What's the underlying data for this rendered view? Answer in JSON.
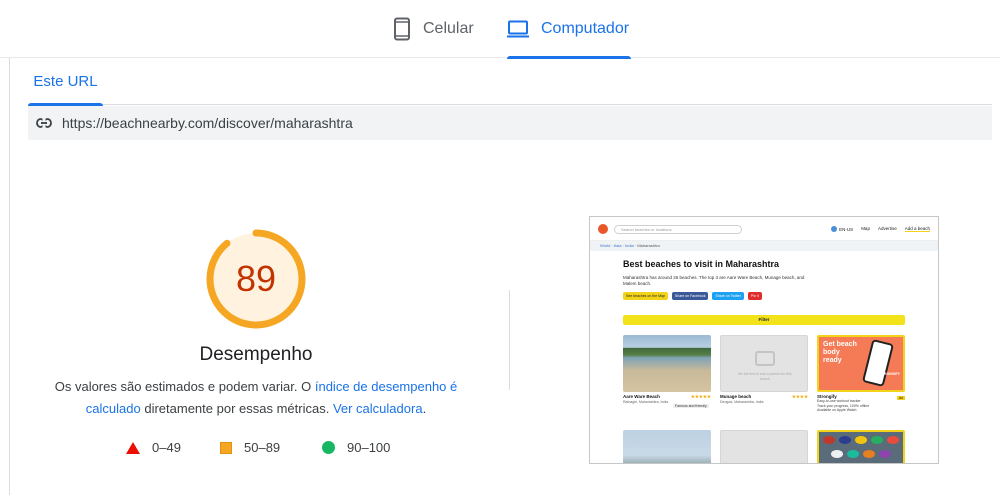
{
  "device_tabs": [
    {
      "label": "Celular",
      "icon": "phone-icon",
      "selected": false
    },
    {
      "label": "Computador",
      "icon": "laptop-icon",
      "selected": true
    }
  ],
  "url_tab": {
    "label": "Este URL"
  },
  "url_bar": {
    "url": "https://beachnearby.com/discover/maharashtra",
    "icon": "link-icon"
  },
  "performance": {
    "score": "89",
    "score_fraction": 0.89,
    "title": "Desempenho",
    "desc_part1": "Os valores são estimados e podem variar. O ",
    "desc_link1": "índice de desempenho é calculado",
    "desc_part2": " diretamente por essas métricas. ",
    "desc_link2": "Ver calculadora",
    "desc_part3": "."
  },
  "legend": [
    {
      "range": "0–49",
      "shape": "triangle",
      "color": "#eb0f00"
    },
    {
      "range": "50–89",
      "shape": "square",
      "color": "#f5a623"
    },
    {
      "range": "90–100",
      "shape": "circle",
      "color": "#18b663"
    }
  ],
  "colors": {
    "accent": "#1a73e8",
    "average": "#f5a623",
    "score_text": "#c33300"
  },
  "preview": {
    "search_placeholder": "Search beaches or locations",
    "nav_lang": "EN-US",
    "nav_map": "Map",
    "nav_advertise": "Advertise",
    "nav_add": "Add a beach",
    "breadcrumb_world": "World",
    "breadcrumb_asia": "Asia",
    "breadcrumb_india": "India",
    "breadcrumb_current": "Maharashtra",
    "heading": "Best beaches to visit in Maharashtra",
    "paragraph": "Maharashtra has around 26 beaches. The top 3 are Aare Ware Beach, Munage beach, and Malem beach.",
    "btn_map": "See beaches on the Map",
    "btn_fb": "Share on Facebook",
    "btn_tw": "Share on Twitter",
    "btn_pin": "Pin it",
    "filter": "Filter",
    "card1_title": "Aare Ware Beach",
    "card1_sub": "Ratnagiri, Maharashtra, India",
    "card1_tag": "Famous and friendly",
    "card2_title": "Munage beach",
    "card2_sub": "Deogad, Maharashtra, India",
    "card2_caption": "Be the first to add a picture for this beach",
    "card3_title": "Strongify",
    "card3_ad_title": "Get beach body ready",
    "card3_brand": "STRONGIFY",
    "card3_line1": "Easy-to-use workout tracker",
    "card3_line2": "Track your progress, 100% offline",
    "card3_line3": "Available on Apple Watch",
    "card3_badge": "Ad",
    "stars": "★★★★★",
    "stars4": "★★★★"
  }
}
